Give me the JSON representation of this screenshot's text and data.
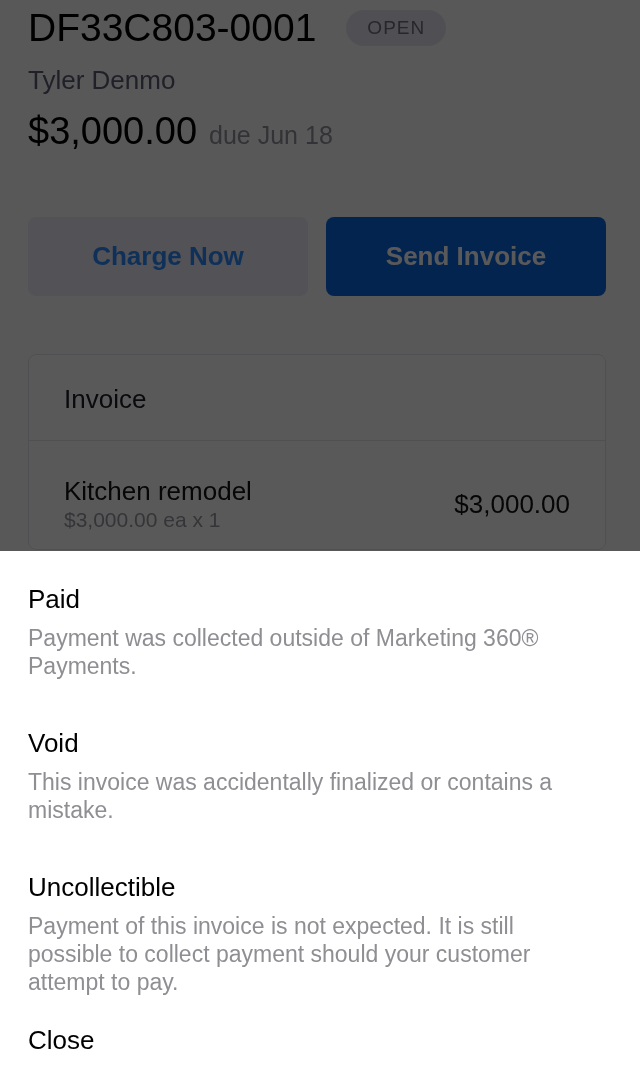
{
  "invoice": {
    "number": "DF33C803-0001",
    "status": "OPEN",
    "customer": "Tyler Denmo",
    "amount": "$3,000.00",
    "due": "due Jun 18"
  },
  "actions": [
    {
      "label": "Charge Now",
      "kind": "secondary"
    },
    {
      "label": "Send Invoice",
      "kind": "primary"
    }
  ],
  "invoice_card": {
    "title": "Invoice",
    "line_items": [
      {
        "name": "Kitchen remodel",
        "detail": "$3,000.00 ea x 1",
        "total": "$3,000.00"
      }
    ]
  },
  "action_sheet": {
    "open": true,
    "options": [
      {
        "title": "Paid",
        "description": "Payment was collected outside of Marketing 360® Payments."
      },
      {
        "title": "Void",
        "description": "This invoice was accidentally finalized or contains a mistake."
      },
      {
        "title": "Uncollectible",
        "description": "Payment of this invoice is not expected. It is still possible to collect payment should your customer attempt to pay."
      }
    ],
    "close": "Close"
  }
}
